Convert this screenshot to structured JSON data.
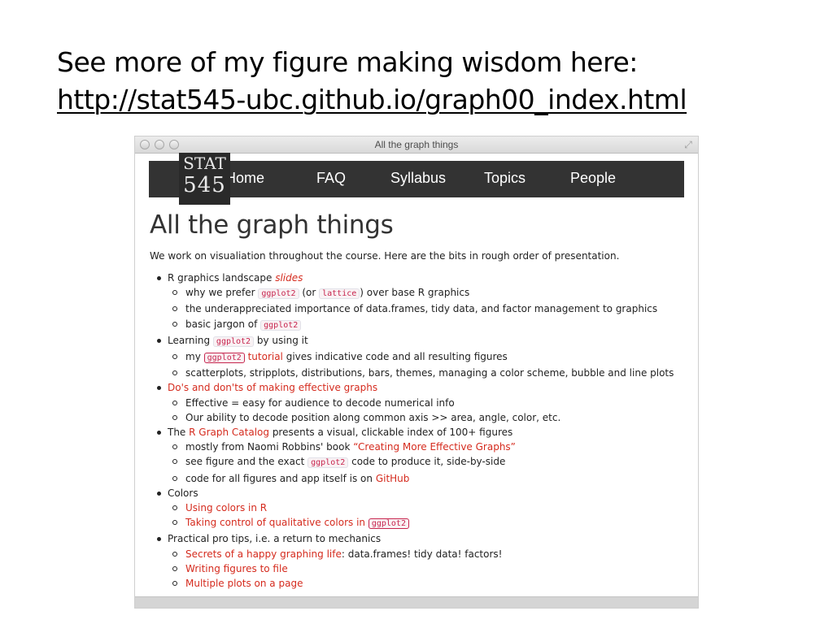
{
  "slide": {
    "line1": "See more of my figure making wisdom here:",
    "url": "http://stat545-ubc.github.io/graph00_index.html"
  },
  "window": {
    "title": "All the graph things"
  },
  "logo": {
    "line1": "STAT",
    "line2": "545"
  },
  "nav": {
    "home": "Home",
    "faq": "FAQ",
    "syllabus": "Syllabus",
    "topics": "Topics",
    "people": "People"
  },
  "page": {
    "heading": "All the graph things",
    "intro": "We work on visualiation throughout the course. Here are the bits in rough order of presentation."
  },
  "items": {
    "i1": {
      "text": "R graphics landscape ",
      "link": "slides"
    },
    "i1a": {
      "t1": "why we prefer ",
      "c1": "ggplot2",
      "t2": " (or ",
      "c2": "lattice",
      "t3": ") over base R graphics"
    },
    "i1b": {
      "text": "the underappreciated importance of data.frames, tidy data, and factor management to graphics"
    },
    "i1c": {
      "t1": "basic jargon of ",
      "c1": "ggplot2"
    },
    "i2": {
      "t1": "Learning ",
      "c1": "ggplot2",
      "t2": " by using it"
    },
    "i2a": {
      "t1": "my ",
      "c1": "ggplot2",
      "link": " tutorial",
      "t2": " gives indicative code and all resulting figures"
    },
    "i2b": {
      "text": "scatterplots, stripplots, distributions, bars, themes, managing a color scheme, bubble and line plots"
    },
    "i3": {
      "link": "Do's and don'ts of making effective graphs"
    },
    "i3a": {
      "text": "Effective = easy for audience to decode numerical info"
    },
    "i3b": {
      "text": "Our ability to decode position along common axis >> area, angle, color, etc."
    },
    "i4": {
      "t1": "The ",
      "link": "R Graph Catalog",
      "t2": " presents a visual, clickable index of 100+ figures"
    },
    "i4a": {
      "t1": "mostly from Naomi Robbins' book ",
      "link": "“Creating More Effective Graphs”"
    },
    "i4b": {
      "t1": "see figure and the exact ",
      "c1": "ggplot2",
      "t2": " code to produce it, side-by-side"
    },
    "i4c": {
      "t1": "code for all figures and app itself is on ",
      "link": "GitHub"
    },
    "i5": {
      "text": "Colors"
    },
    "i5a": {
      "link": "Using colors in R"
    },
    "i5b": {
      "link": "Taking control of qualitative colors in ",
      "c1": "ggplot2"
    },
    "i6": {
      "text": "Practical pro tips, i.e. a return to mechanics"
    },
    "i6a": {
      "link": "Secrets of a happy graphing life",
      "t1": ": data.frames! tidy data! factors!"
    },
    "i6b": {
      "link": "Writing figures to file"
    },
    "i6c": {
      "link": "Multiple plots on a page"
    }
  },
  "colors": {
    "link": "#d52b1e",
    "navbar": "#333333",
    "code": "#c7254e"
  }
}
